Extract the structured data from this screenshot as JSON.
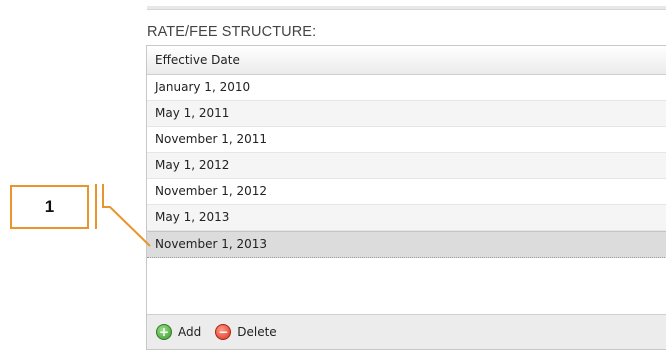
{
  "section": {
    "title": "RATE/FEE STRUCTURE:"
  },
  "grid": {
    "header": "Effective Date",
    "rows": [
      "January 1, 2010",
      "May 1, 2011",
      "November 1, 2011",
      "May 1, 2012",
      "November 1, 2012",
      "May 1, 2013",
      "November 1, 2013"
    ],
    "selected_index": 6
  },
  "toolbar": {
    "add_label": "Add",
    "delete_label": "Delete"
  },
  "callout": {
    "number": "1"
  },
  "colors": {
    "callout": "#e8962c",
    "selected_row": "#dcdcdc"
  }
}
